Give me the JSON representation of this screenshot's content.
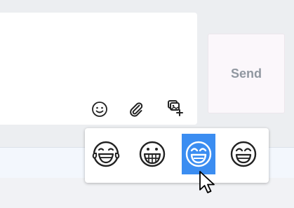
{
  "composer": {
    "send_label": "Send",
    "toolbar": [
      {
        "icon": "smiley-icon",
        "name": "emoji-picker-button"
      },
      {
        "icon": "paperclip-icon",
        "name": "attach-file-button"
      },
      {
        "icon": "image-add-icon",
        "name": "add-screenshot-button"
      }
    ]
  },
  "emoji_picker": {
    "options": [
      {
        "icon": "tears-of-joy-emoji-icon",
        "selected": false
      },
      {
        "icon": "grinning-teeth-emoji-icon",
        "selected": true
      },
      {
        "icon": "smiling-open-mouth-emoji-icon",
        "selected": true
      },
      {
        "icon": "grinning-emoji-icon",
        "selected": false
      }
    ],
    "selected_color": "#3b8df1"
  },
  "colors": {
    "send_text": "#9097a0",
    "icon_stroke": "#222222"
  }
}
